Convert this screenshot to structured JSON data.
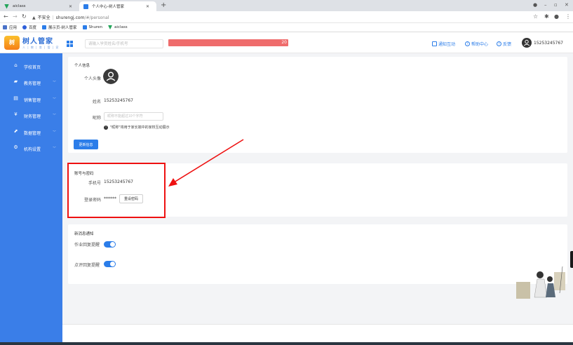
{
  "browser": {
    "tabs": [
      {
        "title": "aiclass"
      },
      {
        "title": "个人中心-树人管家"
      }
    ],
    "url": {
      "security": "不安全",
      "domain": "shurengj.com",
      "path": "/#/personal"
    },
    "bookmarks": [
      {
        "label": "应用"
      },
      {
        "label": "百度"
      },
      {
        "label": "展示页-树人管家"
      },
      {
        "label": "Shuren"
      },
      {
        "label": "aiclass"
      }
    ]
  },
  "header": {
    "brand": "树人管家",
    "brand_sub": "人 | 教 | 育 | 管 | 家",
    "search_placeholder": "请输入学员姓名/手机号",
    "progress_value": "20",
    "links": [
      {
        "label": "通知互动"
      },
      {
        "label": "帮助中心"
      },
      {
        "label": "反馈"
      }
    ],
    "user": "15253245767"
  },
  "sidebar": {
    "items": [
      {
        "label": "学校首页",
        "icon": "home-icon",
        "glyph": "⌂"
      },
      {
        "label": "教务管理",
        "icon": "book-icon",
        "glyph": "▰"
      },
      {
        "label": "销售管理",
        "icon": "document-icon",
        "glyph": "▤"
      },
      {
        "label": "财务管理",
        "icon": "yen-icon",
        "glyph": "¥"
      },
      {
        "label": "数据管理",
        "icon": "chart-icon",
        "glyph": "⬈"
      },
      {
        "label": "机构设置",
        "icon": "gear-icon",
        "glyph": "⚙"
      }
    ]
  },
  "personal": {
    "title": "个人信息",
    "avatar_label": "个人头像",
    "name_label": "姓名",
    "name_value": "15253245767",
    "nick_label": "昵称",
    "nick_placeholder": "昵称不能超过10个字符",
    "hint": "\"昵称\"将用于家长端中的家校互动展示",
    "update_button": "更新信息"
  },
  "account": {
    "title": "账号与密码",
    "phone_label": "手机号",
    "phone_value": "15253245767",
    "pwd_label": "登录密码",
    "pwd_value": "******",
    "reset_button": "重设密码"
  },
  "notify": {
    "title": "新消息通知",
    "items": [
      {
        "label": "作业回复提醒",
        "on": true
      },
      {
        "label": "点评回复提醒",
        "on": true
      }
    ]
  },
  "colors": {
    "sidebar": "#3a7ee8",
    "primary": "#2b7de9",
    "progress": "#ef6c6c",
    "highlight": "#ee1111"
  }
}
